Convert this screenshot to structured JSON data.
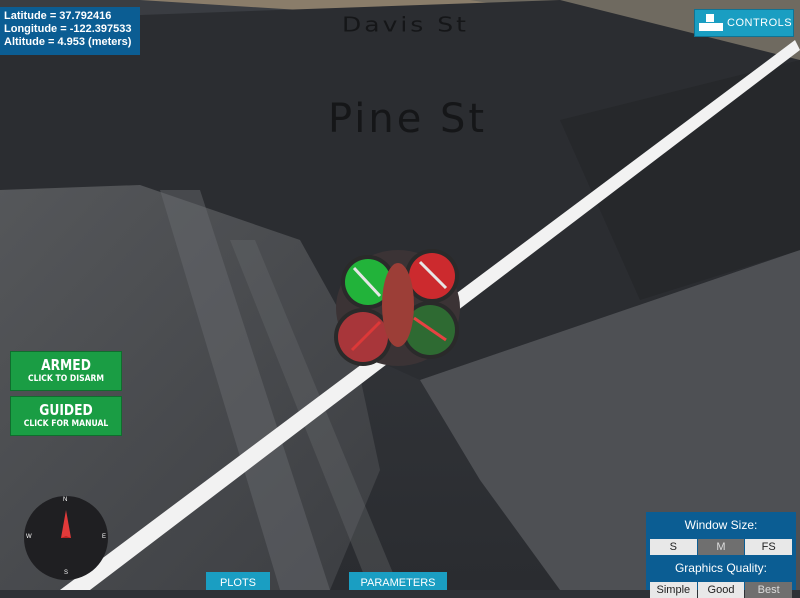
{
  "scene": {
    "street_labels": [
      "Davis St",
      "Pine St"
    ]
  },
  "readout": {
    "latitude": "Latitude = 37.792416",
    "longitude": "Longitude = -122.397533",
    "altitude": "Altitude = 4.953 (meters)"
  },
  "controls": {
    "label": "CONTROLS",
    "icon": "controls-grid-icon"
  },
  "modes": {
    "armed": {
      "title": "ARMED",
      "subtitle": "CLICK TO DISARM"
    },
    "guided": {
      "title": "GUIDED",
      "subtitle": "CLICK FOR MANUAL"
    }
  },
  "compass": {
    "north": "N",
    "east": "E",
    "south": "S",
    "west": "W",
    "icon": "compass-needle-icon"
  },
  "settings": {
    "window_size_title": "Window Size:",
    "window_sizes": [
      "S",
      "M",
      "FS"
    ],
    "window_size_selected": "M",
    "graphics_title": "Graphics Quality:",
    "graphics_options": [
      "Simple",
      "Good",
      "Best"
    ],
    "graphics_selected": "Best"
  },
  "tabs": {
    "plots": "PLOTS",
    "parameters": "PARAMETERS"
  },
  "colors": {
    "accent_blue": "#1a9ec2",
    "panel_blue": "#0b5d93",
    "mode_green": "#1a9d44"
  }
}
